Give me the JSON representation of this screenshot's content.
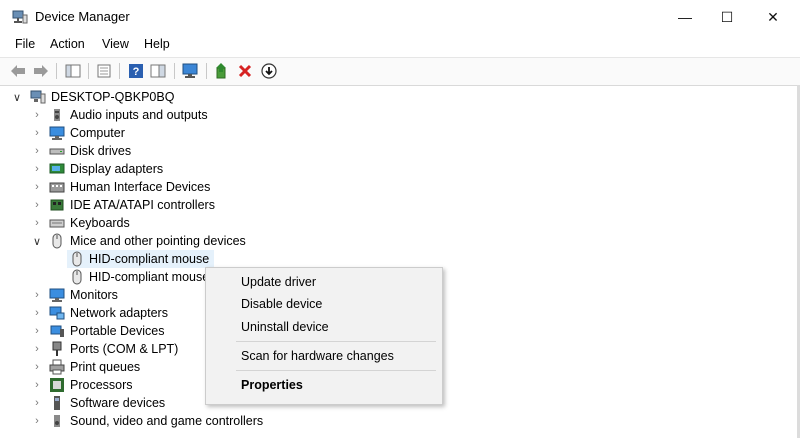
{
  "window": {
    "title": "Device Manager",
    "minimize": "—",
    "maximize": "☐",
    "close": "✕"
  },
  "menu": [
    "File",
    "Action",
    "View",
    "Help"
  ],
  "tree": {
    "root": "DESKTOP-QBKP0BQ",
    "items": [
      {
        "label": "Audio inputs and outputs",
        "icon": "speaker-icon",
        "expanded": false
      },
      {
        "label": "Computer",
        "icon": "monitor-icon",
        "expanded": false
      },
      {
        "label": "Disk drives",
        "icon": "disk-drive-icon",
        "expanded": false
      },
      {
        "label": "Display adapters",
        "icon": "display-adapter-icon",
        "expanded": false
      },
      {
        "label": "Human Interface Devices",
        "icon": "hid-icon",
        "expanded": false
      },
      {
        "label": "IDE ATA/ATAPI controllers",
        "icon": "ide-controller-icon",
        "expanded": false
      },
      {
        "label": "Keyboards",
        "icon": "keyboard-icon",
        "expanded": false
      },
      {
        "label": "Mice and other pointing devices",
        "icon": "mouse-icon",
        "expanded": true,
        "children": [
          {
            "label": "HID-compliant mouse",
            "icon": "mouse-icon",
            "selected": true
          },
          {
            "label": "HID-compliant mouse",
            "icon": "mouse-icon",
            "selected": false
          }
        ]
      },
      {
        "label": "Monitors",
        "icon": "monitor-icon",
        "expanded": false
      },
      {
        "label": "Network adapters",
        "icon": "network-adapter-icon",
        "expanded": false
      },
      {
        "label": "Portable Devices",
        "icon": "portable-device-icon",
        "expanded": false
      },
      {
        "label": "Ports (COM & LPT)",
        "icon": "port-icon",
        "expanded": false
      },
      {
        "label": "Print queues",
        "icon": "printer-icon",
        "expanded": false
      },
      {
        "label": "Processors",
        "icon": "processor-icon",
        "expanded": false
      },
      {
        "label": "Software devices",
        "icon": "software-device-icon",
        "expanded": false
      },
      {
        "label": "Sound, video and game controllers",
        "icon": "sound-controller-icon",
        "expanded": false
      }
    ]
  },
  "context_menu": {
    "items": [
      "Update driver",
      "Disable device",
      "Uninstall device",
      "Scan for hardware changes",
      "Properties"
    ]
  },
  "colors": {
    "selection": "#e5f1fb",
    "menu_bg": "#f2f2f2",
    "accent_blue": "#2a7bd4",
    "delete_red": "#d62222"
  }
}
